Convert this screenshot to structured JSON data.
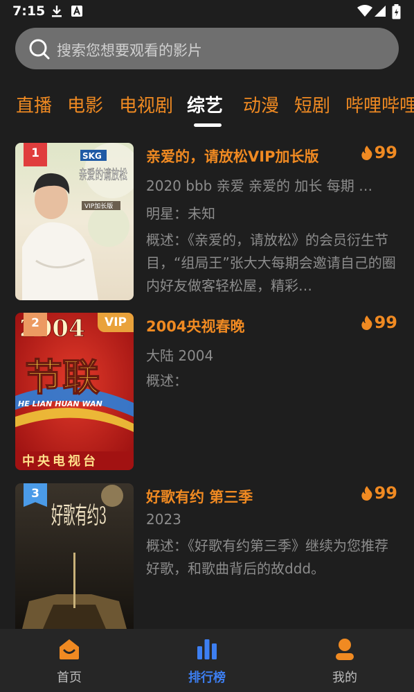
{
  "status_bar": {
    "time": "7:15"
  },
  "search": {
    "placeholder": "搜索您想要观看的影片"
  },
  "tabs": [
    {
      "label": "直播",
      "active": false
    },
    {
      "label": "电影",
      "active": false
    },
    {
      "label": "电视剧",
      "active": false
    },
    {
      "label": "综艺",
      "active": true
    },
    {
      "label": "动漫",
      "active": false
    },
    {
      "label": "短剧",
      "active": false
    },
    {
      "label": "哔哩哔哩",
      "active": false
    }
  ],
  "items": [
    {
      "rank": "1",
      "title": "亲爱的，请放松VIP加长版",
      "heat": "99",
      "meta1": "2020 bbb 亲爱 亲爱的 加长 每期 …",
      "meta2": "明星：未知",
      "desc": "概述：《亲爱的，请放松》的会员衍生节目，“组局王”张大大每期会邀请自己的圈内好友做客轻松屋，精彩…",
      "poster_text": "亲爱的请放松",
      "poster_logo": "SKG",
      "poster_sub": "VIP加长版"
    },
    {
      "rank": "2",
      "vip": "VIP",
      "title": "2004央视春晚",
      "heat": "99",
      "meta1": "大陆 2004",
      "desc": "概述：",
      "poster_text": "2004",
      "poster_big": "节联",
      "poster_band": "HE LIAN HUAN WAN",
      "poster_sub": "中央电视台"
    },
    {
      "rank": "3",
      "title": "好歌有约 第三季",
      "heat": "99",
      "meta1": "2023",
      "desc": "概述：《好歌有约第三季》继续为您推荐好歌，和歌曲背后的故ddd。",
      "poster_text": "好歌有约3"
    }
  ],
  "bottom_nav": [
    {
      "label": "首页",
      "icon": "home-icon",
      "active": false
    },
    {
      "label": "排行榜",
      "icon": "bar-chart-icon",
      "active": true
    },
    {
      "label": "我的",
      "icon": "profile-icon",
      "active": false
    }
  ],
  "colors": {
    "accent": "#f08a22",
    "active_nav": "#3d7ff2",
    "background": "#1e1e1e"
  }
}
